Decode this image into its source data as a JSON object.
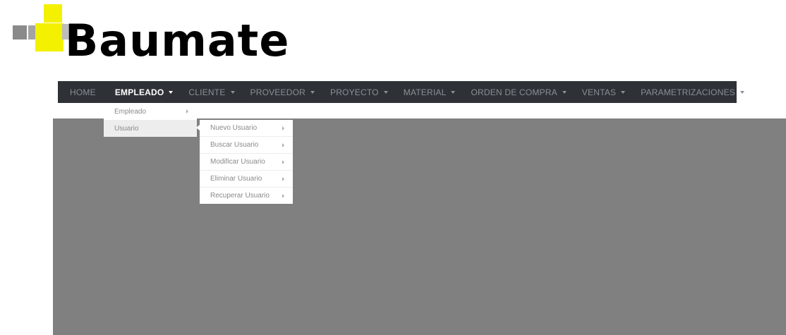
{
  "logo": {
    "text": "Baumate"
  },
  "nav": {
    "items": [
      {
        "label": "HOME",
        "caret": false,
        "active": false
      },
      {
        "label": "EMPLEADO",
        "caret": true,
        "active": true
      },
      {
        "label": "CLIENTE",
        "caret": true,
        "active": false
      },
      {
        "label": "PROVEEDOR",
        "caret": true,
        "active": false
      },
      {
        "label": "PROYECTO",
        "caret": true,
        "active": false
      },
      {
        "label": "MATERIAL",
        "caret": true,
        "active": false
      },
      {
        "label": "ORDEN DE COMPRA",
        "caret": true,
        "active": false
      },
      {
        "label": "VENTAS",
        "caret": true,
        "active": false
      },
      {
        "label": "PARAMETRIZACIONES",
        "caret": true,
        "active": false
      }
    ]
  },
  "empleado_menu": {
    "items": [
      {
        "label": "Empleado",
        "selected": false
      },
      {
        "label": "Usuario",
        "selected": true
      }
    ]
  },
  "usuario_menu": {
    "items": [
      {
        "label": "Nuevo Usuario"
      },
      {
        "label": "Buscar Usuario"
      },
      {
        "label": "Modificar Usuario"
      },
      {
        "label": "Eliminar Usuario"
      },
      {
        "label": "Recuperar Usuario"
      }
    ]
  },
  "colors": {
    "navbar": "#2e3237",
    "nav_text": "#8b8f96",
    "nav_active": "#ffffff",
    "content_bg": "#808080",
    "logo_yellow": "#f3f000"
  }
}
